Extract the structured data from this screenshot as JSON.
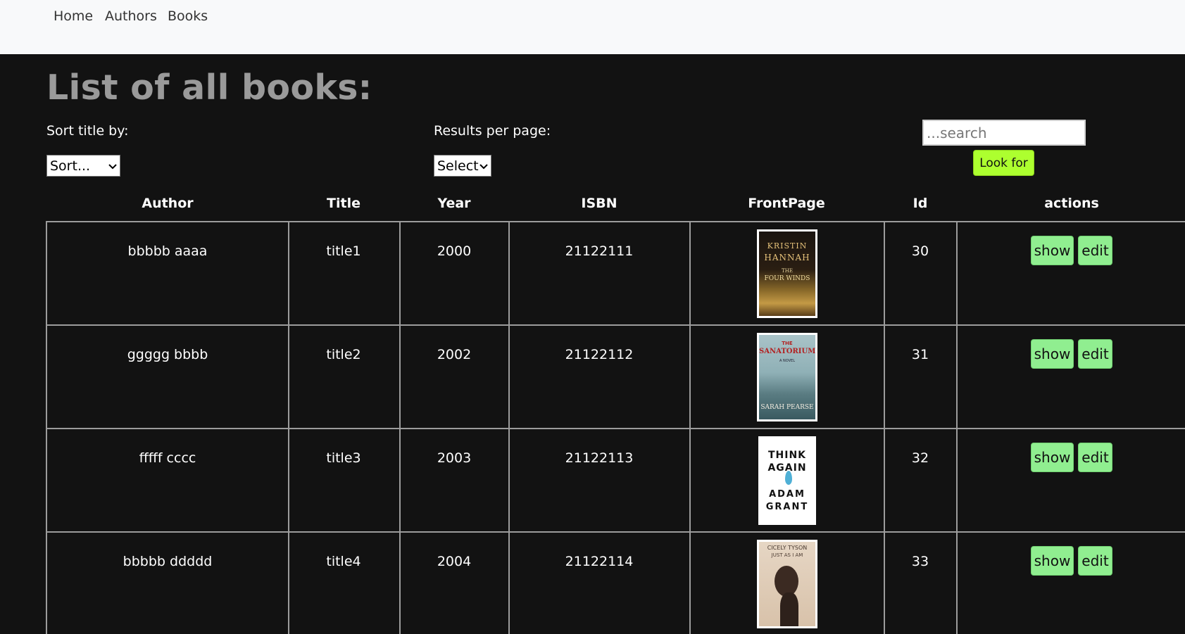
{
  "nav": {
    "home": "Home",
    "authors": "Authors",
    "books": "Books"
  },
  "page_title": "List of all books:",
  "controls": {
    "sort_label": "Sort title by:",
    "sort_value": "Sort...",
    "per_page_label": "Results per page:",
    "per_page_value": "Select",
    "search_placeholder": "...search",
    "look_for_label": "Look for"
  },
  "table": {
    "headers": [
      "Author",
      "Title",
      "Year",
      "ISBN",
      "FrontPage",
      "Id",
      "actions"
    ],
    "rows": [
      {
        "author": "bbbbb aaaa",
        "title": "title1",
        "year": "2000",
        "isbn": "21122111",
        "id": "30",
        "cover": {
          "line1": "KRISTIN",
          "line2": "HANNAH",
          "line3": "THE",
          "line4": "FOUR WINDS"
        }
      },
      {
        "author": "ggggg bbbb",
        "title": "title2",
        "year": "2002",
        "isbn": "21122112",
        "id": "31",
        "cover": {
          "line1": "THE",
          "line2": "SANATORIUM",
          "line3": "A NOVEL",
          "line4": "SARAH PEARSE"
        }
      },
      {
        "author": "fffff cccc",
        "title": "title3",
        "year": "2003",
        "isbn": "21122113",
        "id": "32",
        "cover": {
          "line1": "THINK",
          "line2": "AGAIN",
          "line3": "ADAM",
          "line4": "GRANT"
        }
      },
      {
        "author": "bbbbb ddddd",
        "title": "title4",
        "year": "2004",
        "isbn": "21122114",
        "id": "33",
        "cover": {
          "line1": "CICELY TYSON",
          "line2": "JUST AS I AM"
        }
      }
    ],
    "show_label": "show",
    "edit_label": "edit"
  },
  "colors": {
    "background": "#121212",
    "nav_background": "#f8f9fa",
    "title": "#9a9a9a",
    "look_for_button": "#adff2f",
    "action_button": "#90ee90"
  }
}
